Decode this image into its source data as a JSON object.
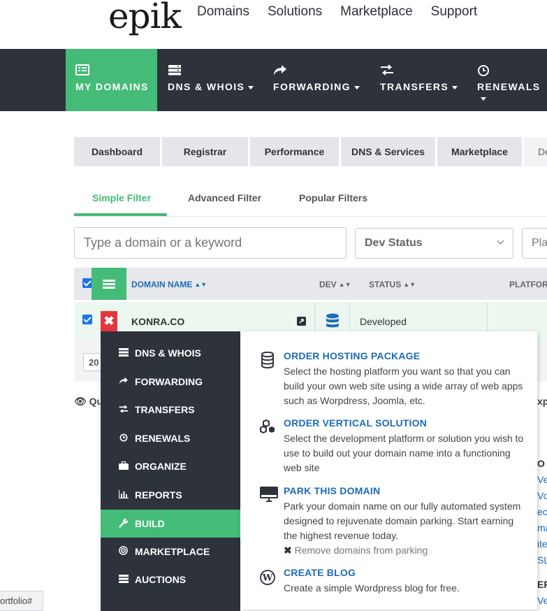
{
  "brand": {
    "logo": "epik"
  },
  "top_nav": [
    "Domains",
    "Solutions",
    "Marketplace",
    "Support"
  ],
  "main_nav": [
    {
      "label": "MY DOMAINS",
      "icon": "list-icon",
      "active": true
    },
    {
      "label": "DNS & WHOIS",
      "icon": "server-icon",
      "caret": true
    },
    {
      "label": "FORWARDING",
      "icon": "share-arrow-icon",
      "caret": true
    },
    {
      "label": "TRANSFERS",
      "icon": "exchange-icon",
      "caret": true
    },
    {
      "label": "RENEWALS",
      "icon": "clock-icon",
      "caret": true
    }
  ],
  "tabs": [
    "Dashboard",
    "Registrar",
    "Performance",
    "DNS & Services",
    "Marketplace",
    "Dev"
  ],
  "filter_tabs": [
    "Simple Filter",
    "Advanced Filter",
    "Popular Filters"
  ],
  "search": {
    "placeholder": "Type a domain or a keyword"
  },
  "dev_status_select": "Dev Status",
  "platform_select": "Pla",
  "table": {
    "headers": {
      "domain": "DOMAIN NAME",
      "dev": "DEV",
      "status": "STATUS",
      "platform": "PLATFOR"
    },
    "row": {
      "domain": "KONRA.CO",
      "status": "Developed"
    },
    "page_size": "20"
  },
  "peek": {
    "left_label": "Qu",
    "right_label": "xp",
    "side_letters": [
      "O",
      "Ve",
      "Vo",
      "ec",
      "ma",
      "ite",
      "SL",
      "ER",
      "Ve"
    ]
  },
  "menu": {
    "items": [
      {
        "label": "DNS & WHOIS",
        "icon": "server-icon"
      },
      {
        "label": "FORWARDING",
        "icon": "share-arrow-icon"
      },
      {
        "label": "TRANSFERS",
        "icon": "exchange-icon"
      },
      {
        "label": "RENEWALS",
        "icon": "clock-icon"
      },
      {
        "label": "ORGANIZE",
        "icon": "briefcase-icon"
      },
      {
        "label": "REPORTS",
        "icon": "bar-chart-icon"
      },
      {
        "label": "BUILD",
        "icon": "wrench-icon",
        "active": true
      },
      {
        "label": "MARKETPLACE",
        "icon": "target-icon"
      },
      {
        "label": "AUCTIONS",
        "icon": "server-icon"
      }
    ],
    "options": [
      {
        "title": "ORDER HOSTING PACKAGE",
        "icon": "database-icon",
        "lines": [
          "Select the hosting platform you want so that you can",
          "build your own web site using a wide array of web apps",
          "such as Worpdress, Joomla, etc."
        ]
      },
      {
        "title": "ORDER VERTICAL SOLUTION",
        "icon": "cubes-icon",
        "lines": [
          "Select the development platform or solution you wish to",
          "use to build out your domain name into a functioning",
          "web site"
        ]
      },
      {
        "title": "PARK THIS DOMAIN",
        "icon": "monitor-icon",
        "lines": [
          "Park your domain name on our fully automated system",
          "designed to rejuvenate domain parking. Start earning",
          "the highest revenue today."
        ],
        "extra": "Remove domains from parking"
      },
      {
        "title": "CREATE BLOG",
        "icon": "wordpress-icon",
        "lines": [
          "Create a simple Wordpress blog for free."
        ]
      }
    ]
  },
  "status_bar": "ortfolio#",
  "colors": {
    "green": "#44bb76",
    "dark": "#2e323b",
    "blue": "#1d6bb8",
    "red": "#e4373d"
  }
}
